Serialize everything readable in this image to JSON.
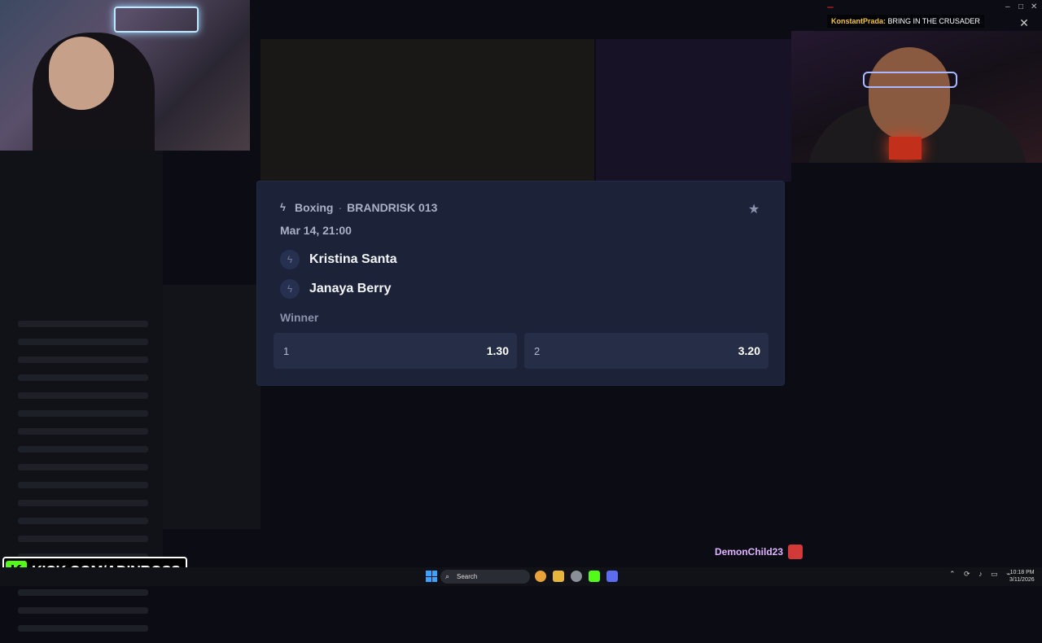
{
  "chat": {
    "badge": "",
    "username": "KonstantPrada:",
    "message": "BRING IN THE CRUSADER"
  },
  "event": {
    "sport": "Boxing",
    "separator": "·",
    "league": "BRANDRISK 013",
    "date": "Mar 14, 21:00",
    "fighters": [
      "Kristina Santa",
      "Janaya Berry"
    ],
    "market": "Winner",
    "outcomes": [
      {
        "label": "1",
        "odds": "1.30"
      },
      {
        "label": "2",
        "odds": "3.20"
      }
    ]
  },
  "overlay": {
    "logo_text": "KICK.COM/ADINROSS",
    "tip_username": "DemonChild23"
  },
  "taskbar": {
    "search_label": "Search",
    "time": "10:18 PM",
    "date": "3/11/2026"
  },
  "colors": {
    "card_bg": "#1c2338",
    "button_bg": "#252d47",
    "kick_green": "#53fc18"
  }
}
